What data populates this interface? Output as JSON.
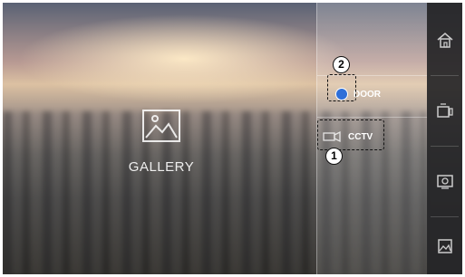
{
  "gallery": {
    "label": "GALLERY",
    "icon": "image-icon"
  },
  "menu": {
    "door": {
      "label": "DOOR",
      "icon": "door-dot-icon",
      "dot_color": "#2f6fd8"
    },
    "cctv": {
      "label": "CCTV",
      "icon": "cctv-camera-icon"
    }
  },
  "callouts": [
    {
      "number": "1"
    },
    {
      "number": "2"
    }
  ],
  "sidebar": {
    "items": [
      {
        "name": "home",
        "icon": "home-icon"
      },
      {
        "name": "interphone",
        "icon": "interphone-icon"
      },
      {
        "name": "camera-view",
        "icon": "camera-view-icon"
      },
      {
        "name": "gallery",
        "icon": "gallery-icon"
      }
    ]
  }
}
